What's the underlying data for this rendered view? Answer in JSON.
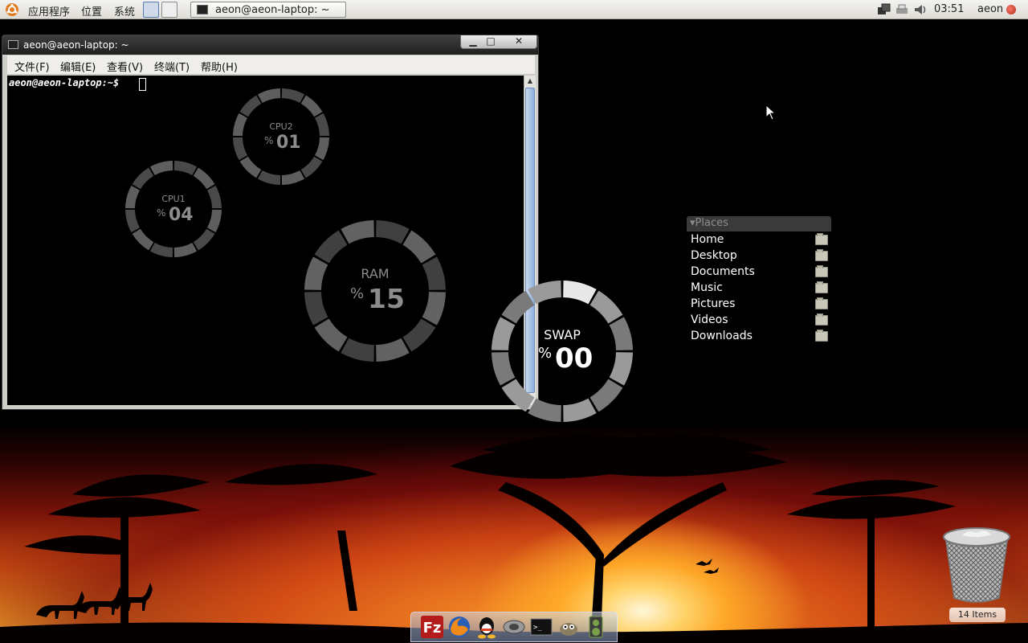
{
  "top_panel": {
    "menus": [
      "应用程序",
      "位置",
      "系统"
    ],
    "task_title": "aeon@aeon-laptop: ~",
    "clock": "03:51",
    "user": "aeon"
  },
  "terminal": {
    "title": "aeon@aeon-laptop:  ~",
    "menus": [
      "文件(F)",
      "编辑(E)",
      "查看(V)",
      "终端(T)",
      "帮助(H)"
    ],
    "prompt": "aeon@aeon-laptop:~$ "
  },
  "gauges": {
    "cpu2": {
      "label": "CPU2",
      "pct": "%",
      "value": "01"
    },
    "cpu1": {
      "label": "CPU1",
      "pct": "%",
      "value": "04"
    },
    "ram": {
      "label": "RAM",
      "pct": "%",
      "value": "15"
    },
    "swap": {
      "label": "SWAP",
      "pct": "%",
      "value": "00"
    }
  },
  "places": {
    "header": "▾Places",
    "items": [
      "Home",
      "Desktop",
      "Documents",
      "Music",
      "Pictures",
      "Videos",
      "Downloads"
    ]
  },
  "trash": {
    "badge": "14 Items"
  },
  "dock": {
    "icons": [
      "filezilla-icon",
      "firefox-icon",
      "qq-icon",
      "network-icon",
      "terminal-icon",
      "gimp-icon",
      "speaker-icon"
    ]
  }
}
